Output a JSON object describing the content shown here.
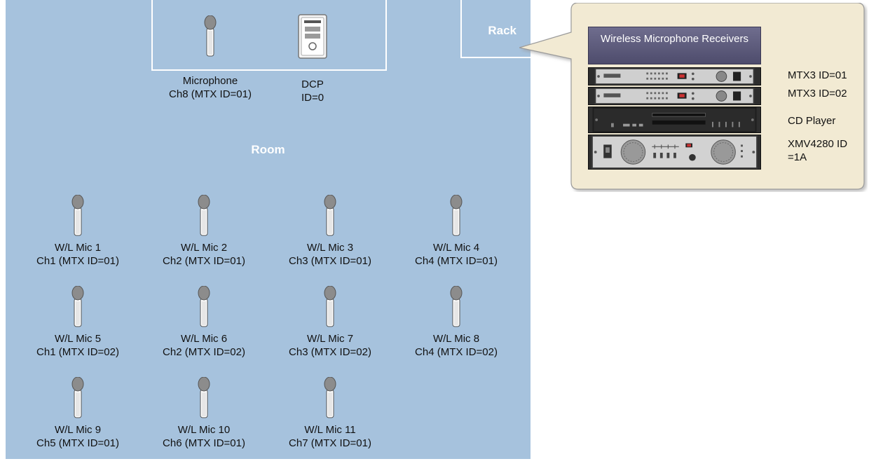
{
  "room": {
    "title": "Room"
  },
  "rack": {
    "label": "Rack"
  },
  "top_items": {
    "microphone": {
      "line1": "Microphone",
      "line2": "Ch8 (MTX ID=01)"
    },
    "dcp": {
      "line1": "DCP",
      "line2": "ID=0"
    }
  },
  "mics": [
    {
      "name": "W/L Mic 1",
      "channel": "Ch1 (MTX ID=01)"
    },
    {
      "name": "W/L Mic 2",
      "channel": "Ch2 (MTX ID=01)"
    },
    {
      "name": "W/L Mic 3",
      "channel": "Ch3 (MTX ID=01)"
    },
    {
      "name": "W/L Mic 4",
      "channel": "Ch4 (MTX ID=01)"
    },
    {
      "name": "W/L Mic 5",
      "channel": "Ch1 (MTX ID=02)"
    },
    {
      "name": "W/L Mic 6",
      "channel": "Ch2 (MTX ID=02)"
    },
    {
      "name": "W/L Mic 7",
      "channel": "Ch3 (MTX ID=02)"
    },
    {
      "name": "W/L Mic 8",
      "channel": "Ch4 (MTX ID=02)"
    },
    {
      "name": "W/L Mic 9",
      "channel": "Ch5 (MTX ID=01)"
    },
    {
      "name": "W/L Mic 10",
      "channel": "Ch6 (MTX ID=01)"
    },
    {
      "name": "W/L Mic 11",
      "channel": "Ch7 (MTX ID=01)"
    }
  ],
  "callout": {
    "receiver_label": "Wireless Microphone Receivers",
    "devices": [
      {
        "label": "MTX3 ID=01"
      },
      {
        "label": "MTX3 ID=02"
      },
      {
        "label": "CD Player"
      },
      {
        "label": "XMV4280 ID =1A"
      }
    ]
  },
  "colors": {
    "room": "#a6c2dd",
    "callout_fill": "#f2ead3",
    "receiver": "#5d5b7d"
  }
}
